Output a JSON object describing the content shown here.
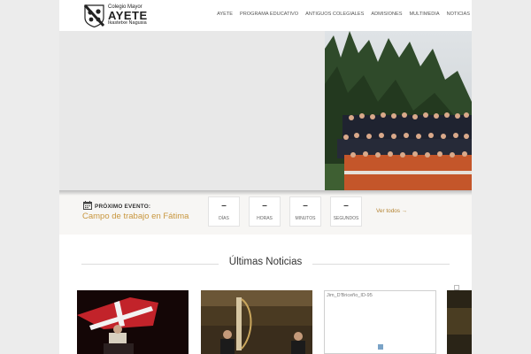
{
  "header": {
    "logo": {
      "top": "Colegio Mayor",
      "main": "AYETE",
      "bottom": "Ikastetxe Nagusia"
    },
    "nav": [
      "AYETE",
      "PROGRAMA EDUCATIVO",
      "ANTIGUOS COLEGIALES",
      "ADMISIONES",
      "MULTIMEDIA",
      "NOTICIAS"
    ]
  },
  "event": {
    "label": "PRÓXIMO EVENTO:",
    "title": "Campo de trabajo en Fátima",
    "countdown": [
      {
        "value": "–",
        "label": "DÍAS"
      },
      {
        "value": "–",
        "label": "HORAS"
      },
      {
        "value": "–",
        "label": "MINUTOS"
      },
      {
        "value": "–",
        "label": "SEGUNDOS"
      }
    ],
    "see_all": "Ver todos →"
  },
  "news": {
    "title": "Últimas Noticias",
    "broken_image_alt": "Jim_D'Briceño_ID-95"
  },
  "colors": {
    "accent": "#c8963e",
    "background": "#ececec"
  },
  "icons": [
    "crest-logo",
    "calendar-icon",
    "broken-image-icon"
  ]
}
